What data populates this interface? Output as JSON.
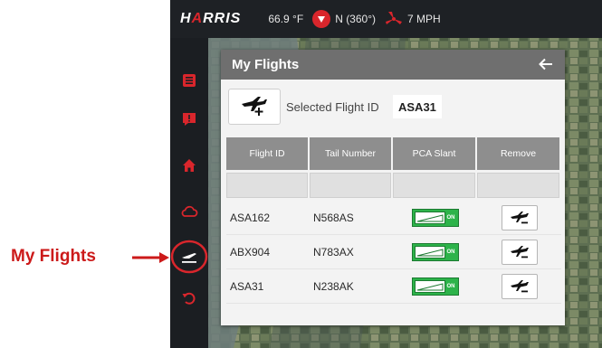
{
  "callout": {
    "label": "My Flights",
    "color": "#cc1a1a"
  },
  "topbar": {
    "brand_h": "H",
    "brand_a": "A",
    "brand_rest": "RRIS",
    "temperature": "66.9 °F",
    "wind_direction": "N (360°)",
    "wind_speed": "7 MPH"
  },
  "sidebar": {
    "items": [
      {
        "icon": "list-icon"
      },
      {
        "icon": "alert-icon"
      },
      {
        "icon": "home-icon"
      },
      {
        "icon": "cloud-icon"
      },
      {
        "icon": "flights-icon",
        "highlighted": true
      },
      {
        "icon": "refresh-icon"
      }
    ],
    "accent": "#d9262c"
  },
  "panel": {
    "title": "My Flights",
    "selected_label": "Selected Flight ID",
    "selected_value": "ASA31",
    "table": {
      "headers": [
        "Flight ID",
        "Tail Number",
        "PCA Slant",
        "Remove"
      ],
      "rows": [
        {
          "flight_id": "ASA162",
          "tail_number": "N568AS",
          "pca_slant": "ON"
        },
        {
          "flight_id": "ABX904",
          "tail_number": "N783AX",
          "pca_slant": "ON"
        },
        {
          "flight_id": "ASA31",
          "tail_number": "N238AK",
          "pca_slant": "ON"
        }
      ]
    }
  }
}
